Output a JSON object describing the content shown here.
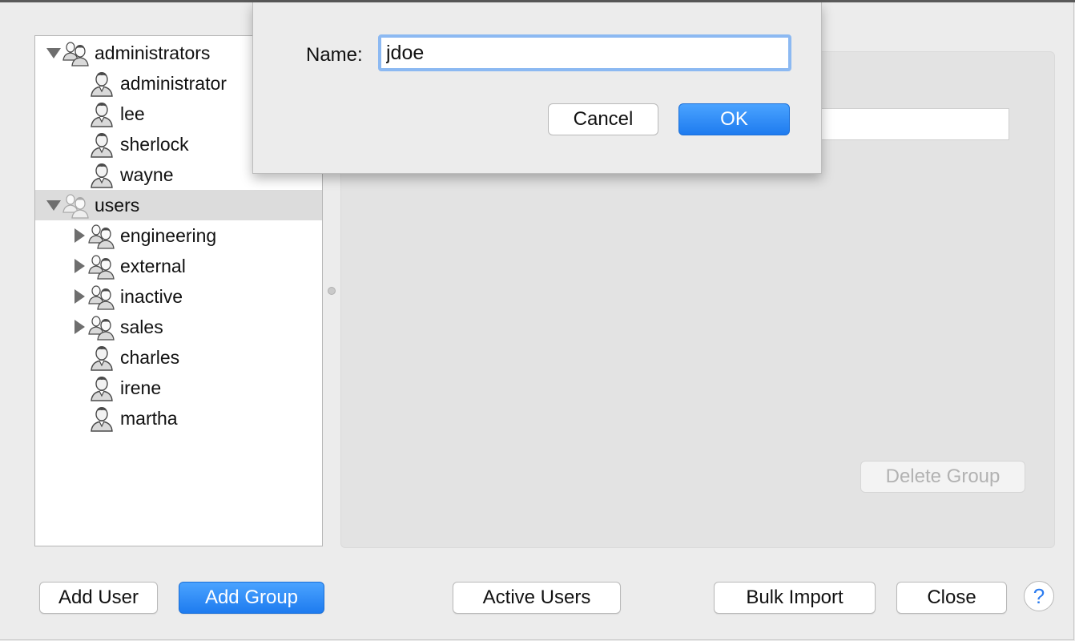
{
  "tree": {
    "items": [
      {
        "label": "administrators",
        "kind": "group",
        "level": 0,
        "disclosure": "expanded",
        "selected": false
      },
      {
        "label": "administrator",
        "kind": "user",
        "level": 1,
        "disclosure": "none",
        "selected": false
      },
      {
        "label": "lee",
        "kind": "user",
        "level": 1,
        "disclosure": "none",
        "selected": false
      },
      {
        "label": "sherlock",
        "kind": "user",
        "level": 1,
        "disclosure": "none",
        "selected": false
      },
      {
        "label": "wayne",
        "kind": "user",
        "level": 1,
        "disclosure": "none",
        "selected": false
      },
      {
        "label": "users",
        "kind": "group-faded",
        "level": 0,
        "disclosure": "expanded",
        "selected": true
      },
      {
        "label": "engineering",
        "kind": "group",
        "level": 1,
        "disclosure": "collapsed",
        "selected": false
      },
      {
        "label": "external",
        "kind": "group",
        "level": 1,
        "disclosure": "collapsed",
        "selected": false
      },
      {
        "label": "inactive",
        "kind": "group",
        "level": 1,
        "disclosure": "collapsed",
        "selected": false
      },
      {
        "label": "sales",
        "kind": "group",
        "level": 1,
        "disclosure": "collapsed",
        "selected": false
      },
      {
        "label": "charles",
        "kind": "user",
        "level": 1,
        "disclosure": "none",
        "selected": false
      },
      {
        "label": "irene",
        "kind": "user",
        "level": 1,
        "disclosure": "none",
        "selected": false
      },
      {
        "label": "martha",
        "kind": "user",
        "level": 1,
        "disclosure": "none",
        "selected": false
      }
    ]
  },
  "detail": {
    "delete_group_label": "Delete Group"
  },
  "footer": {
    "add_user_label": "Add User",
    "add_group_label": "Add Group",
    "active_users_label": "Active Users",
    "bulk_import_label": "Bulk Import",
    "close_label": "Close",
    "help_label": "?"
  },
  "dialog": {
    "name_label": "Name:",
    "name_value": "jdoe",
    "cancel_label": "Cancel",
    "ok_label": "OK"
  },
  "colors": {
    "accent": "#1e7bef",
    "focus_ring": "#8cb9f2",
    "selection": "#dcdcdc"
  }
}
